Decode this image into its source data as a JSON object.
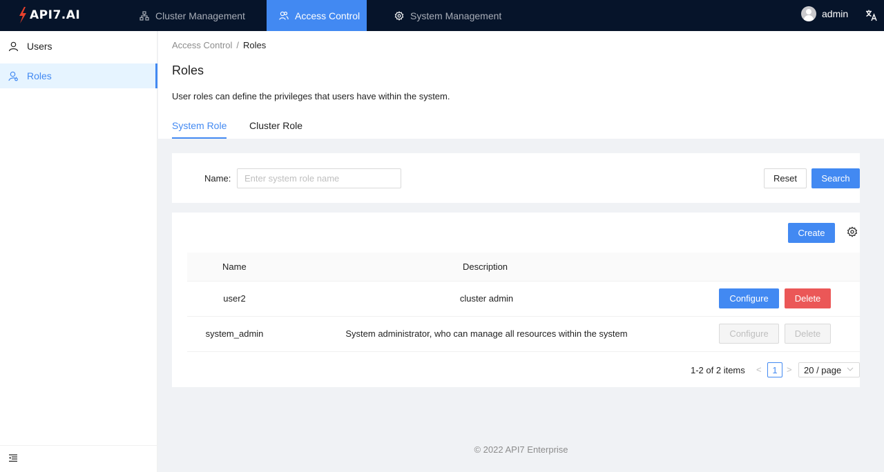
{
  "header": {
    "logo_text": "API7.AI",
    "nav": [
      {
        "label": "Cluster Management",
        "icon": "cluster-icon",
        "active": false
      },
      {
        "label": "Access Control",
        "icon": "access-control-icon",
        "active": true
      },
      {
        "label": "System Management",
        "icon": "gear-icon",
        "active": false
      }
    ],
    "user": {
      "name": "admin",
      "icon": "avatar-icon"
    },
    "language_icon": "translate-icon"
  },
  "sidebar": {
    "items": [
      {
        "label": "Users",
        "icon": "user-icon",
        "active": false
      },
      {
        "label": "Roles",
        "icon": "user-role-icon",
        "active": true
      }
    ],
    "collapse_icon": "menu-fold-icon"
  },
  "page": {
    "breadcrumb": [
      "Access Control",
      "Roles"
    ],
    "breadcrumb_separator": "/",
    "title": "Roles",
    "description": "User roles can define the privileges that users have within the system.",
    "tabs": [
      {
        "label": "System Role",
        "active": true
      },
      {
        "label": "Cluster Role",
        "active": false
      }
    ]
  },
  "search": {
    "name_label": "Name",
    "name_colon": ":",
    "name_value": "",
    "name_placeholder": "Enter system role name",
    "reset_label": "Reset",
    "search_label": "Search"
  },
  "table": {
    "create_label": "Create",
    "settings_icon": "gear-icon",
    "columns": [
      "Name",
      "Description"
    ],
    "rows": [
      {
        "name": "user2",
        "description": "cluster admin",
        "configure_label": "Configure",
        "delete_label": "Delete",
        "actions_enabled": true
      },
      {
        "name": "system_admin",
        "description": "System administrator, who can manage all resources within the system",
        "configure_label": "Configure",
        "delete_label": "Delete",
        "actions_enabled": false
      }
    ]
  },
  "pagination": {
    "total_text": "1-2 of 2 items",
    "current_page": "1",
    "prev_symbol": "<",
    "next_symbol": ">",
    "page_size": "20 / page"
  },
  "footer": {
    "text": "© 2022 API7 Enterprise"
  },
  "colors": {
    "header_bg": "#06142a",
    "primary": "#4289f2",
    "danger": "#eb5757",
    "logo_accent": "#e8412c"
  }
}
